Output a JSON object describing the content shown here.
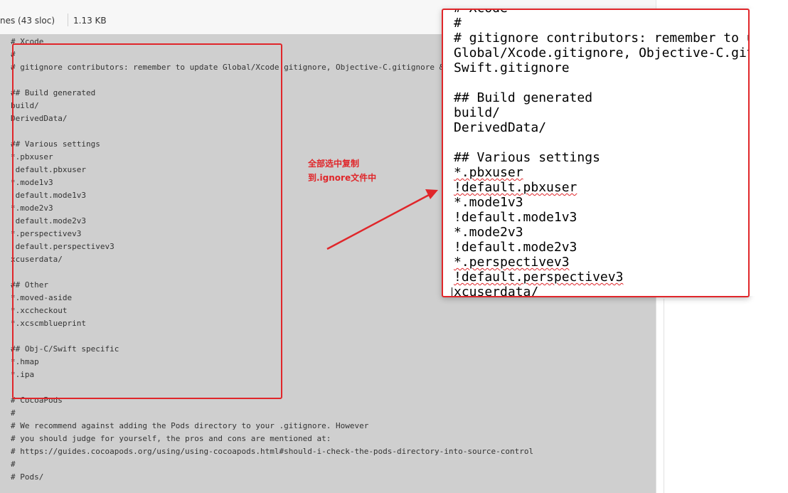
{
  "file_info": {
    "lines_text": "nes (43 sloc)",
    "size_text": "1.13 KB"
  },
  "code_lines": [
    {
      "text": "# Xcode"
    },
    {
      "text": "#"
    },
    {
      "text": "# gitignore contributors: remember to update Global/Xcode.gitignore, Objective-C.gitignore & S"
    },
    {
      "text": ""
    },
    {
      "text": "## Build generated"
    },
    {
      "text": "build/"
    },
    {
      "text": "DerivedData/"
    },
    {
      "text": ""
    },
    {
      "text": "## Various settings"
    },
    {
      "text": "*.pbxuser"
    },
    {
      "text": " default.pbxuser"
    },
    {
      "text": "*.mode1v3"
    },
    {
      "text": " default.mode1v3"
    },
    {
      "text": "*.mode2v3"
    },
    {
      "text": " default.mode2v3"
    },
    {
      "text": "*.perspectivev3"
    },
    {
      "text": " default.perspectivev3"
    },
    {
      "text": "xcuserdata/"
    },
    {
      "text": ""
    },
    {
      "text": "## Other"
    },
    {
      "text": "*.moved-aside"
    },
    {
      "text": "*.xccheckout"
    },
    {
      "text": "*.xcscmblueprint"
    },
    {
      "text": ""
    },
    {
      "text": "## Obj-C/Swift specific"
    },
    {
      "text": "*.hmap"
    },
    {
      "text": "*.ipa"
    },
    {
      "text": ""
    },
    {
      "text": "# CocoaPods"
    },
    {
      "text": "#"
    },
    {
      "text": "# We recommend against adding the Pods directory to your .gitignore. However"
    },
    {
      "text": "# you should judge for yourself, the pros and cons are mentioned at:"
    },
    {
      "text": "# https://guides.cocoapods.org/using/using-cocoapods.html#should-i-check-the-pods-directory-into-source-control"
    },
    {
      "text": "#"
    },
    {
      "text": "# Pods/"
    }
  ],
  "annotation": {
    "line1": "全部选中复制",
    "line2": "到.ignore文件中",
    "color": "#e0262a"
  },
  "editor_lines": [
    "# Xcode",
    "#",
    "# gitignore contributors: remember to update",
    "Global/Xcode.gitignore, Objective-C.gitignore",
    "Swift.gitignore",
    "",
    "## Build generated",
    "build/",
    "DerivedData/",
    "",
    "## Various settings",
    "*.pbxuser",
    "!default.pbxuser",
    "*.mode1v3",
    "!default.mode1v3",
    "*.mode2v3",
    "!default.mode2v3",
    "*.perspectivev3",
    "!default.perspectivev3",
    "xcuserdata/"
  ]
}
